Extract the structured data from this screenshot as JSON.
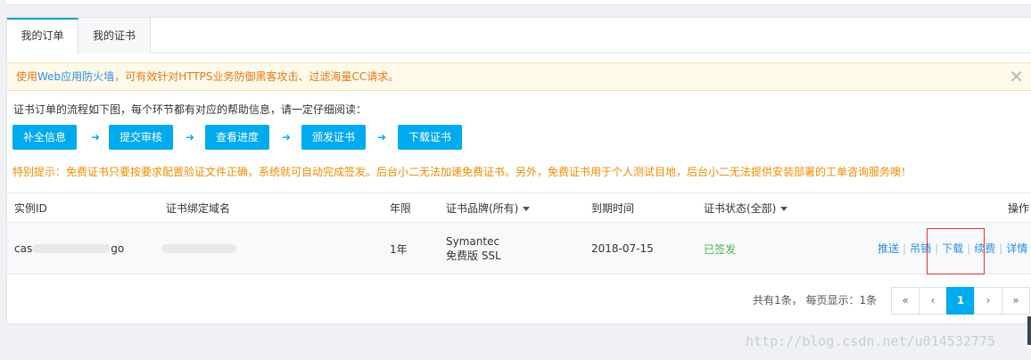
{
  "tabs": [
    {
      "label": "我的订单",
      "active": true
    },
    {
      "label": "我的证书",
      "active": false
    }
  ],
  "notice": {
    "prefix": "使用",
    "link": "Web应用防火墙",
    "suffix": "，可有效针对HTTPS业务防御黑客攻击、过滤海量CC请求。",
    "close_glyph": "✕"
  },
  "flow": {
    "intro": "证书订单的流程如下图，每个环节都有对应的帮助信息，请一定仔细阅读：",
    "steps": [
      "补全信息",
      "提交审核",
      "查看进度",
      "颁发证书",
      "下载证书"
    ],
    "arrow_glyph": "➜"
  },
  "tip": "特别提示：免费证书只要按要求配置验证文件正确，系统就可自动完成签发。后台小二无法加速免费证书。另外，免费证书用于个人测试目地，后台小二无法提供安装部署的工单咨询服务噢！",
  "table": {
    "headers": {
      "instance_id": "实例ID",
      "domain": "证书绑定域名",
      "term": "年限",
      "brand": "证书品牌(所有)",
      "expire": "到期时间",
      "status": "证书状态(全部)",
      "ops": "操作"
    },
    "rows": [
      {
        "instance_prefix": "cas",
        "instance_suffix": "go",
        "term": "1年",
        "brand_line1": "Symantec",
        "brand_line2": "免费版 SSL",
        "expire": "2018-07-15",
        "status": "已签发",
        "ops": [
          "推送",
          "吊销",
          "下载",
          "续费",
          "详情"
        ]
      }
    ]
  },
  "pagination": {
    "info": "共有1条， 每页显示：1条",
    "first": "«",
    "prev": "‹",
    "current": "1",
    "next": "›",
    "last": "»"
  },
  "watermark": "http://blog.csdn.net/u014532775",
  "colors": {
    "accent": "#00aaee",
    "tab_active_border": "#00a2ca",
    "notice_text": "#e07a1b",
    "tip_text": "#f08c00",
    "status_ok": "#4cb349",
    "link": "#2d8ee8",
    "highlight_box": "#e8312f"
  }
}
